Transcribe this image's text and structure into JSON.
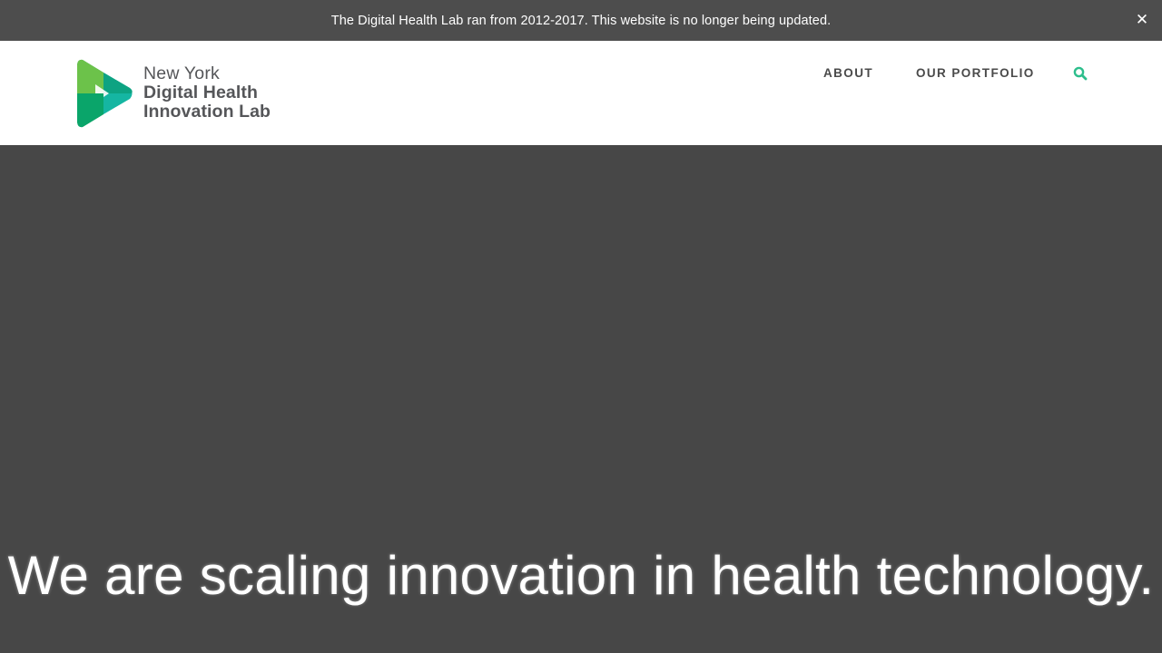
{
  "notice": {
    "text": "The Digital Health Lab ran from 2012-2017. This website is no longer being updated.",
    "close_glyph": "✕",
    "close_icon": "close-icon"
  },
  "header": {
    "logo": {
      "line1": "New York",
      "line2": "Digital Health",
      "line3": "Innovation Lab",
      "colors": {
        "green_light": "#6cc24a",
        "green": "#0b9a46",
        "teal": "#15b6a2",
        "text": "#555659"
      }
    },
    "nav": {
      "about": "ABOUT",
      "portfolio": "OUR PORTFOLIO",
      "search_icon": "search-icon"
    },
    "accent_color": "#2dbe8c"
  },
  "hero": {
    "headline": "We are scaling innovation in health technology.",
    "background_color": "#474747"
  }
}
